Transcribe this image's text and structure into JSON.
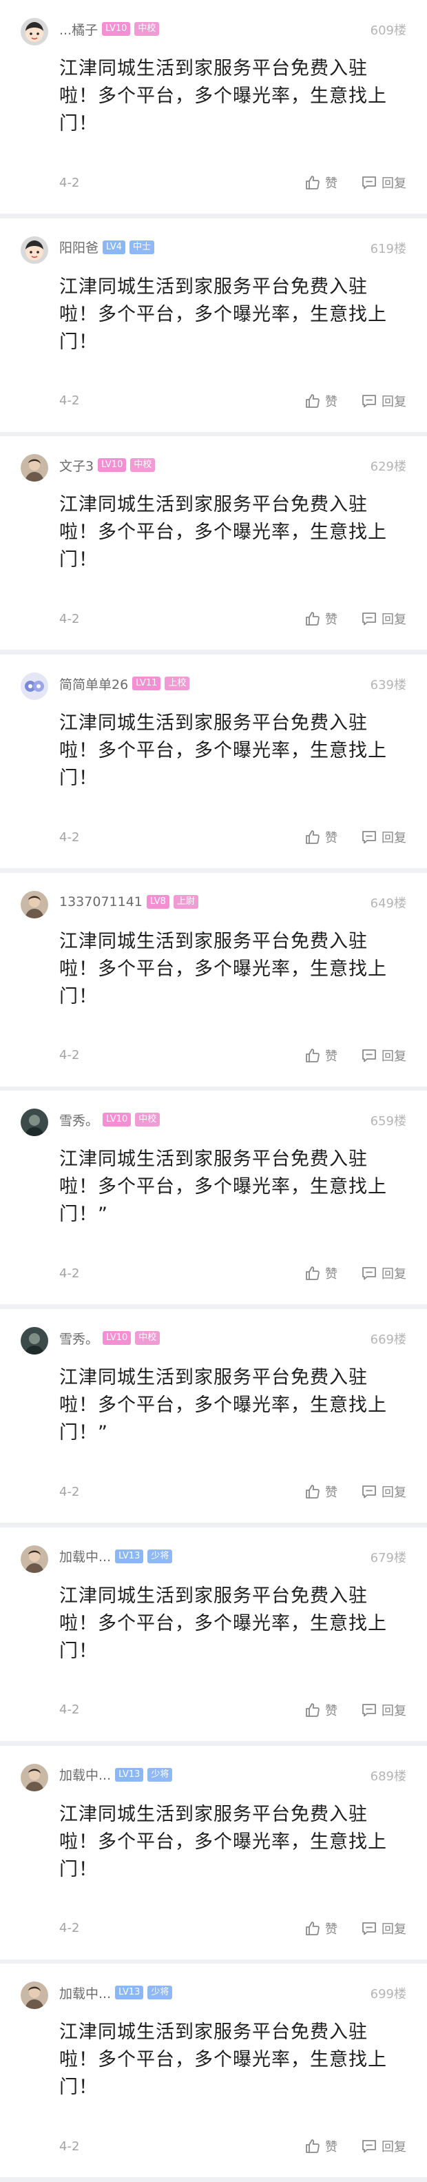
{
  "colors": {
    "level_badge_pink": "#f48fd3",
    "level_badge_blue": "#8cb7f5",
    "rank_badge_pink": "#f19bd5",
    "rank_badge_blue": "#8fb8f4"
  },
  "comments": [
    {
      "username": "...橘子",
      "level": "LV10",
      "rank": "中校",
      "badge_color": "pink",
      "avatar_icon": "cartoon-face-icon",
      "floor": "609楼",
      "content": "江津同城生活到家服务平台免费入驻啦！多个平台，多个曝光率，生意找上门！",
      "date": "4-2",
      "like_label": "赞",
      "reply_label": "回复"
    },
    {
      "username": "阳阳爸",
      "level": "LV4",
      "rank": "中士",
      "badge_color": "blue",
      "avatar_icon": "cartoon-face-icon",
      "floor": "619楼",
      "content": "江津同城生活到家服务平台免费入驻啦！多个平台，多个曝光率，生意找上门！",
      "date": "4-2",
      "like_label": "赞",
      "reply_label": "回复"
    },
    {
      "username": "文子3",
      "level": "LV10",
      "rank": "中校",
      "badge_color": "pink",
      "avatar_icon": "photo-avatar-icon",
      "floor": "629楼",
      "content": "江津同城生活到家服务平台免费入驻啦！多个平台，多个曝光率，生意找上门！",
      "date": "4-2",
      "like_label": "赞",
      "reply_label": "回复"
    },
    {
      "username": "简简单单26",
      "level": "LV11",
      "rank": "上校",
      "badge_color": "pink",
      "avatar_icon": "cartoon-text-avatar-icon",
      "floor": "639楼",
      "content": "江津同城生活到家服务平台免费入驻啦！多个平台，多个曝光率，生意找上门！",
      "date": "4-2",
      "like_label": "赞",
      "reply_label": "回复"
    },
    {
      "username": "1337071141",
      "level": "LV8",
      "rank": "上尉",
      "badge_color": "pink",
      "avatar_icon": "photo-avatar-icon",
      "floor": "649楼",
      "content": "江津同城生活到家服务平台免费入驻啦！多个平台，多个曝光率，生意找上门！",
      "date": "4-2",
      "like_label": "赞",
      "reply_label": "回复"
    },
    {
      "username": "雪秀。",
      "level": "LV10",
      "rank": "中校",
      "badge_color": "pink",
      "avatar_icon": "dark-photo-avatar-icon",
      "floor": "659楼",
      "content": "江津同城生活到家服务平台免费入驻啦！多个平台，多个曝光率，生意找上门！”",
      "date": "4-2",
      "like_label": "赞",
      "reply_label": "回复"
    },
    {
      "username": "雪秀。",
      "level": "LV10",
      "rank": "中校",
      "badge_color": "pink",
      "avatar_icon": "dark-photo-avatar-icon",
      "floor": "669楼",
      "content": "江津同城生活到家服务平台免费入驻啦！多个平台，多个曝光率，生意找上门！”",
      "date": "4-2",
      "like_label": "赞",
      "reply_label": "回复"
    },
    {
      "username": "加载中...",
      "level": "LV13",
      "rank": "少将",
      "badge_color": "blue",
      "avatar_icon": "photo-avatar-icon",
      "floor": "679楼",
      "content": "江津同城生活到家服务平台免费入驻啦！多个平台，多个曝光率，生意找上门！",
      "date": "4-2",
      "like_label": "赞",
      "reply_label": "回复"
    },
    {
      "username": "加载中...",
      "level": "LV13",
      "rank": "少将",
      "badge_color": "blue",
      "avatar_icon": "photo-avatar-icon",
      "floor": "689楼",
      "content": "江津同城生活到家服务平台免费入驻啦！多个平台，多个曝光率，生意找上门！",
      "date": "4-2",
      "like_label": "赞",
      "reply_label": "回复"
    },
    {
      "username": "加载中...",
      "level": "LV13",
      "rank": "少将",
      "badge_color": "blue",
      "avatar_icon": "photo-avatar-icon",
      "floor": "699楼",
      "content": "江津同城生活到家服务平台免费入驻啦！多个平台，多个曝光率，生意找上门！",
      "date": "4-2",
      "like_label": "赞",
      "reply_label": "回复"
    }
  ]
}
